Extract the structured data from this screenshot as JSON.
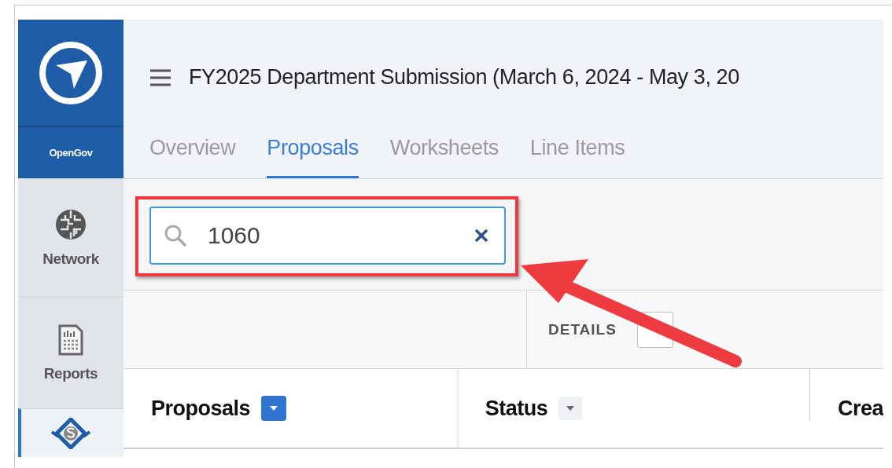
{
  "sidebar": {
    "brand": "OpenGov",
    "items": [
      {
        "label": "Network",
        "kind": "network",
        "selected": false
      },
      {
        "label": "Reports",
        "kind": "reports",
        "selected": false
      },
      {
        "kind": "budget",
        "selected": true
      }
    ]
  },
  "header": {
    "title": "FY2025 Department Submission (March 6, 2024 - May 3, 20"
  },
  "tabs": [
    {
      "label": "Overview",
      "selected": false
    },
    {
      "label": "Proposals",
      "selected": true
    },
    {
      "label": "Worksheets",
      "selected": false
    },
    {
      "label": "Line Items",
      "selected": false
    }
  ],
  "search": {
    "value": "1060"
  },
  "details": {
    "label": "DETAILS"
  },
  "table": {
    "columns": [
      {
        "label": "Proposals",
        "kind": "primary"
      },
      {
        "label": "Status",
        "kind": "sortable"
      },
      {
        "label": "Crea",
        "kind": "plain"
      }
    ]
  }
}
